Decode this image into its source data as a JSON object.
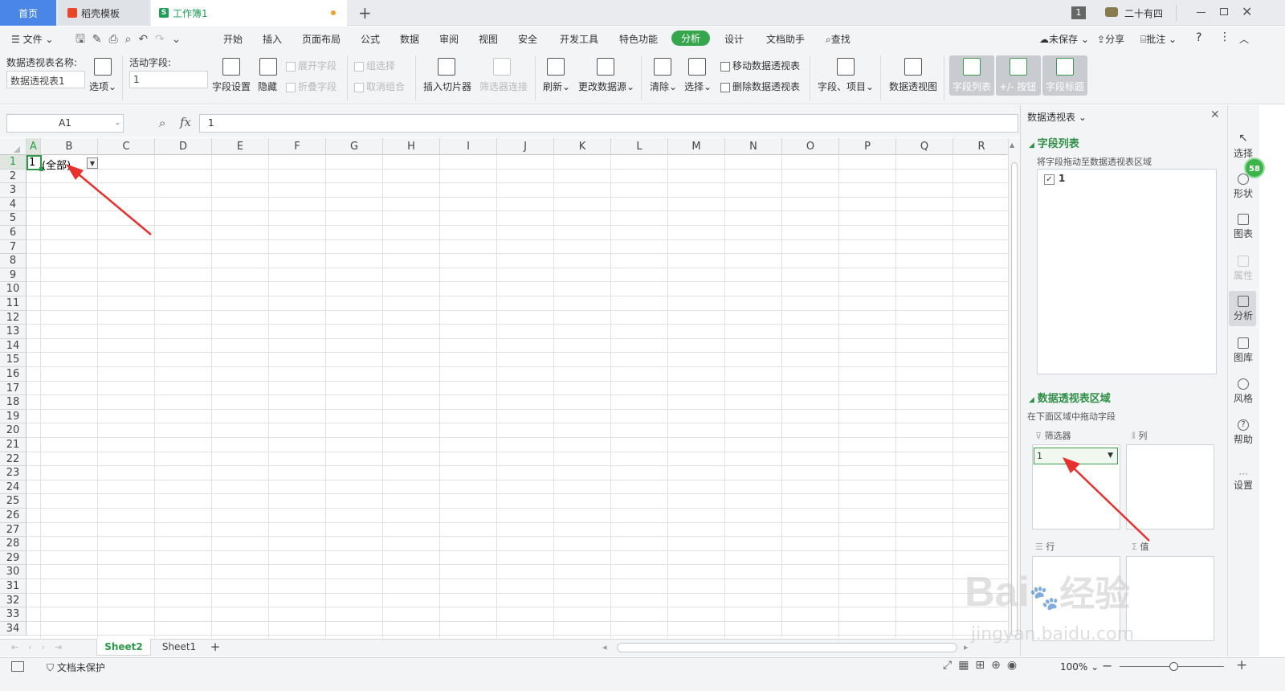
{
  "tabs": {
    "home": "首页",
    "template": "稻壳模板",
    "workbook": "工作簿1"
  },
  "titlebar": {
    "badge": "1",
    "user": "二十有四"
  },
  "menu": {
    "file": "文件",
    "items": [
      "开始",
      "插入",
      "页面布局",
      "公式",
      "数据",
      "审阅",
      "视图",
      "安全",
      "开发工具",
      "特色功能",
      "分析",
      "设计",
      "文档助手"
    ],
    "search": "查找",
    "unsaved": "未保存",
    "share": "分享",
    "comment": "批注",
    "help": "?"
  },
  "ribbon": {
    "pt_name_label": "数据透视表名称:",
    "pt_name_value": "数据透视表1",
    "options": "选项",
    "active_field_label": "活动字段:",
    "active_field_value": "1",
    "field_settings": "字段设置",
    "hide": "隐藏",
    "expand_field": "展开字段",
    "collapse_field": "折叠字段",
    "group_selection": "组选择",
    "ungroup": "取消组合",
    "insert_slicer": "插入切片器",
    "filter_connection": "筛选器连接",
    "refresh": "刷新",
    "change_source": "更改数据源",
    "clear": "清除",
    "select": "选择",
    "move_pt": "移动数据透视表",
    "delete_pt": "删除数据透视表",
    "fields_items": "字段、项目",
    "pivot_chart": "数据透视图",
    "field_list": "字段列表",
    "buttons": "+/- 按钮",
    "field_headers": "字段标题"
  },
  "formula": {
    "cell_ref": "A1",
    "fx": "fx",
    "content": "1"
  },
  "grid": {
    "columns": [
      "A",
      "B",
      "C",
      "D",
      "E",
      "F",
      "G",
      "H",
      "I",
      "J",
      "K",
      "L",
      "M",
      "N",
      "O",
      "P",
      "Q",
      "R"
    ],
    "rows": [
      "1",
      "2",
      "3",
      "4",
      "5",
      "6",
      "7",
      "8",
      "9",
      "10",
      "11",
      "12",
      "13",
      "14",
      "15",
      "16",
      "17",
      "18",
      "19",
      "20",
      "21",
      "22",
      "23",
      "24",
      "25",
      "26",
      "27",
      "28",
      "29",
      "30",
      "31",
      "32",
      "33",
      "34"
    ],
    "a1": "1",
    "b1": "(全部)"
  },
  "sheets": {
    "active": "Sheet2",
    "other": "Sheet1",
    "add": "+"
  },
  "status": {
    "protect": "文档未保护",
    "zoom": "100%"
  },
  "pane": {
    "title": "数据透视表",
    "field_list_heading": "字段列表",
    "field_list_hint": "将字段拖动至数据透视表区域",
    "field_item": "1",
    "areas_heading": "数据透视表区域",
    "areas_hint": "在下面区域中拖动字段",
    "filter_label": "筛选器",
    "filter_value": "1",
    "column_label": "列",
    "row_label": "行",
    "value_label": "值"
  },
  "sidebar": {
    "items": [
      "选择",
      "形状",
      "图表",
      "属性",
      "分析",
      "图库",
      "风格",
      "帮助",
      "设置"
    ],
    "badge": "58"
  },
  "watermark": {
    "brand": "Bai",
    "brand2": "经验",
    "url": "jingyan.baidu.com"
  },
  "colors": {
    "accent": "#35a64c",
    "arrow": "#e8312f",
    "home_tab": "#4a86e8"
  }
}
